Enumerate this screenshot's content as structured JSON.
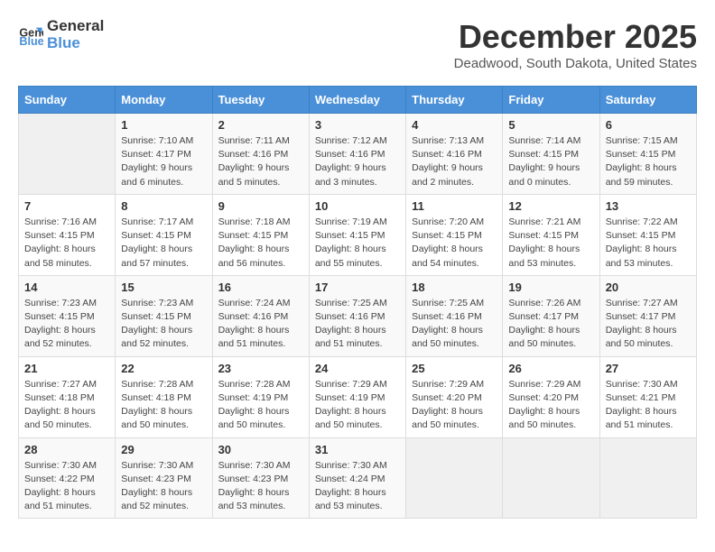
{
  "header": {
    "logo_general": "General",
    "logo_blue": "Blue",
    "month_year": "December 2025",
    "location": "Deadwood, South Dakota, United States"
  },
  "days_of_week": [
    "Sunday",
    "Monday",
    "Tuesday",
    "Wednesday",
    "Thursday",
    "Friday",
    "Saturday"
  ],
  "weeks": [
    [
      {
        "day": "",
        "info": ""
      },
      {
        "day": "1",
        "info": "Sunrise: 7:10 AM\nSunset: 4:17 PM\nDaylight: 9 hours\nand 6 minutes."
      },
      {
        "day": "2",
        "info": "Sunrise: 7:11 AM\nSunset: 4:16 PM\nDaylight: 9 hours\nand 5 minutes."
      },
      {
        "day": "3",
        "info": "Sunrise: 7:12 AM\nSunset: 4:16 PM\nDaylight: 9 hours\nand 3 minutes."
      },
      {
        "day": "4",
        "info": "Sunrise: 7:13 AM\nSunset: 4:16 PM\nDaylight: 9 hours\nand 2 minutes."
      },
      {
        "day": "5",
        "info": "Sunrise: 7:14 AM\nSunset: 4:15 PM\nDaylight: 9 hours\nand 0 minutes."
      },
      {
        "day": "6",
        "info": "Sunrise: 7:15 AM\nSunset: 4:15 PM\nDaylight: 8 hours\nand 59 minutes."
      }
    ],
    [
      {
        "day": "7",
        "info": "Sunrise: 7:16 AM\nSunset: 4:15 PM\nDaylight: 8 hours\nand 58 minutes."
      },
      {
        "day": "8",
        "info": "Sunrise: 7:17 AM\nSunset: 4:15 PM\nDaylight: 8 hours\nand 57 minutes."
      },
      {
        "day": "9",
        "info": "Sunrise: 7:18 AM\nSunset: 4:15 PM\nDaylight: 8 hours\nand 56 minutes."
      },
      {
        "day": "10",
        "info": "Sunrise: 7:19 AM\nSunset: 4:15 PM\nDaylight: 8 hours\nand 55 minutes."
      },
      {
        "day": "11",
        "info": "Sunrise: 7:20 AM\nSunset: 4:15 PM\nDaylight: 8 hours\nand 54 minutes."
      },
      {
        "day": "12",
        "info": "Sunrise: 7:21 AM\nSunset: 4:15 PM\nDaylight: 8 hours\nand 53 minutes."
      },
      {
        "day": "13",
        "info": "Sunrise: 7:22 AM\nSunset: 4:15 PM\nDaylight: 8 hours\nand 53 minutes."
      }
    ],
    [
      {
        "day": "14",
        "info": "Sunrise: 7:23 AM\nSunset: 4:15 PM\nDaylight: 8 hours\nand 52 minutes."
      },
      {
        "day": "15",
        "info": "Sunrise: 7:23 AM\nSunset: 4:15 PM\nDaylight: 8 hours\nand 52 minutes."
      },
      {
        "day": "16",
        "info": "Sunrise: 7:24 AM\nSunset: 4:16 PM\nDaylight: 8 hours\nand 51 minutes."
      },
      {
        "day": "17",
        "info": "Sunrise: 7:25 AM\nSunset: 4:16 PM\nDaylight: 8 hours\nand 51 minutes."
      },
      {
        "day": "18",
        "info": "Sunrise: 7:25 AM\nSunset: 4:16 PM\nDaylight: 8 hours\nand 50 minutes."
      },
      {
        "day": "19",
        "info": "Sunrise: 7:26 AM\nSunset: 4:17 PM\nDaylight: 8 hours\nand 50 minutes."
      },
      {
        "day": "20",
        "info": "Sunrise: 7:27 AM\nSunset: 4:17 PM\nDaylight: 8 hours\nand 50 minutes."
      }
    ],
    [
      {
        "day": "21",
        "info": "Sunrise: 7:27 AM\nSunset: 4:18 PM\nDaylight: 8 hours\nand 50 minutes."
      },
      {
        "day": "22",
        "info": "Sunrise: 7:28 AM\nSunset: 4:18 PM\nDaylight: 8 hours\nand 50 minutes."
      },
      {
        "day": "23",
        "info": "Sunrise: 7:28 AM\nSunset: 4:19 PM\nDaylight: 8 hours\nand 50 minutes."
      },
      {
        "day": "24",
        "info": "Sunrise: 7:29 AM\nSunset: 4:19 PM\nDaylight: 8 hours\nand 50 minutes."
      },
      {
        "day": "25",
        "info": "Sunrise: 7:29 AM\nSunset: 4:20 PM\nDaylight: 8 hours\nand 50 minutes."
      },
      {
        "day": "26",
        "info": "Sunrise: 7:29 AM\nSunset: 4:20 PM\nDaylight: 8 hours\nand 50 minutes."
      },
      {
        "day": "27",
        "info": "Sunrise: 7:30 AM\nSunset: 4:21 PM\nDaylight: 8 hours\nand 51 minutes."
      }
    ],
    [
      {
        "day": "28",
        "info": "Sunrise: 7:30 AM\nSunset: 4:22 PM\nDaylight: 8 hours\nand 51 minutes."
      },
      {
        "day": "29",
        "info": "Sunrise: 7:30 AM\nSunset: 4:23 PM\nDaylight: 8 hours\nand 52 minutes."
      },
      {
        "day": "30",
        "info": "Sunrise: 7:30 AM\nSunset: 4:23 PM\nDaylight: 8 hours\nand 53 minutes."
      },
      {
        "day": "31",
        "info": "Sunrise: 7:30 AM\nSunset: 4:24 PM\nDaylight: 8 hours\nand 53 minutes."
      },
      {
        "day": "",
        "info": ""
      },
      {
        "day": "",
        "info": ""
      },
      {
        "day": "",
        "info": ""
      }
    ]
  ]
}
